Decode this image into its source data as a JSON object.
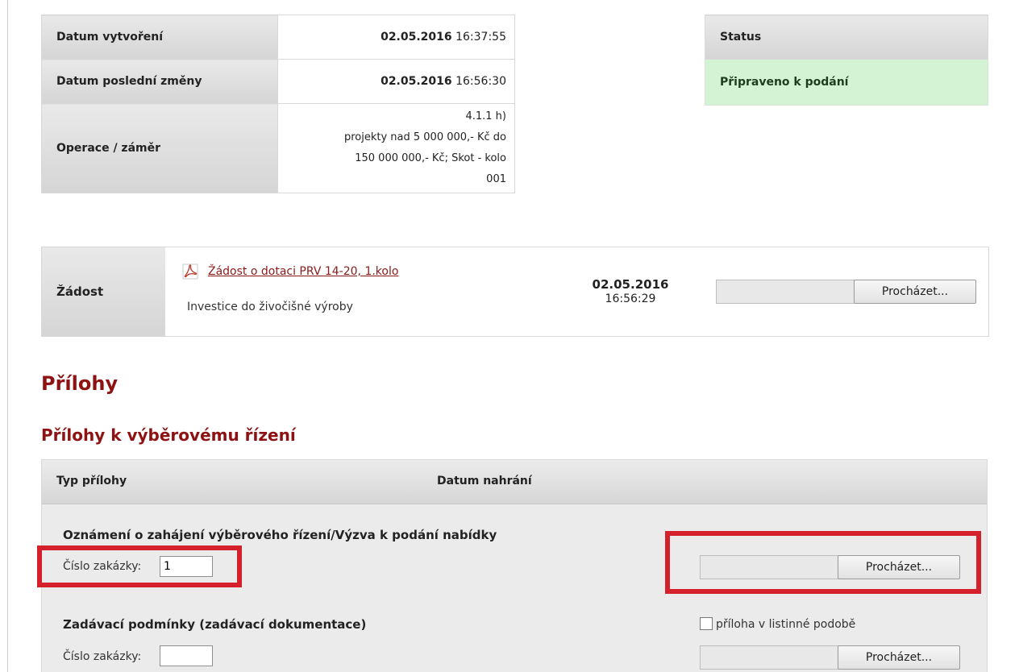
{
  "info": {
    "created_label": "Datum vytvoření",
    "created_date": "02.05.2016",
    "created_time": "16:37:55",
    "modified_label": "Datum poslední změny",
    "modified_date": "02.05.2016",
    "modified_time": "16:56:30",
    "operation_label": "Operace / záměr",
    "operation_lines": [
      "4.1.1 h)",
      "projekty nad 5 000 000,- Kč do",
      "150 000 000,- Kč; Skot - kolo",
      "001"
    ]
  },
  "status": {
    "header": "Status",
    "value": "Připraveno k podání",
    "color": "#d4f3d4"
  },
  "zadost": {
    "label": "Žádost",
    "icon": "pdf-icon",
    "link": "Žádost o dotaci PRV 14-20, 1.kolo",
    "subtitle": "Investice do živočišné výroby",
    "date": "02.05.2016",
    "time": "16:56:29",
    "browse_label": "Procházet..."
  },
  "prilohy": {
    "title": "Přílohy",
    "section_title": "Přílohy k výběrovému řízení",
    "col_type": "Typ přílohy",
    "col_date": "Datum nahrání",
    "items": [
      {
        "title": "Oznámení o zahájení výběrového řízení/Výzva k podání nabídky",
        "number_label": "Číslo zakázky:",
        "number_value": "1",
        "browse_label": "Procházet..."
      },
      {
        "title": "Zadávací podmínky (zadávací dokumentace)",
        "number_label": "Číslo zakázky:",
        "number_value": "",
        "checkbox_label": "příloha v listinné podobě",
        "browse_label": "Procházet..."
      }
    ]
  },
  "colors": {
    "accent": "#8e1212",
    "highlight": "#d4202a"
  }
}
